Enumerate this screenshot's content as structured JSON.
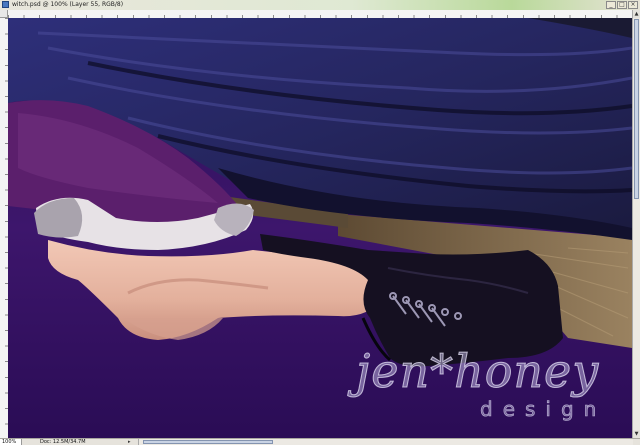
{
  "window": {
    "title": "witch.psd @ 100% (Layer 55, RGB/8)",
    "buttons": {
      "minimize": "_",
      "maximize": "□",
      "close": "×"
    }
  },
  "status": {
    "zoom": "100%",
    "doc_info": "Doc: 12.5M/34.7M",
    "arrow": "▸"
  },
  "watermark": {
    "main": "jen*honey",
    "sub": "design"
  },
  "colors": {
    "background_purple": "#3a1364",
    "cloak_blue": "#27296a",
    "dress_purple": "#5a1f6b",
    "skin": "#e9b9a6",
    "boot": "#151021",
    "broom": "#7a6446"
  },
  "icons": {
    "doc": "document-icon",
    "scroll_up": "scroll-up-arrow-icon",
    "scroll_down": "scroll-down-arrow-icon"
  }
}
